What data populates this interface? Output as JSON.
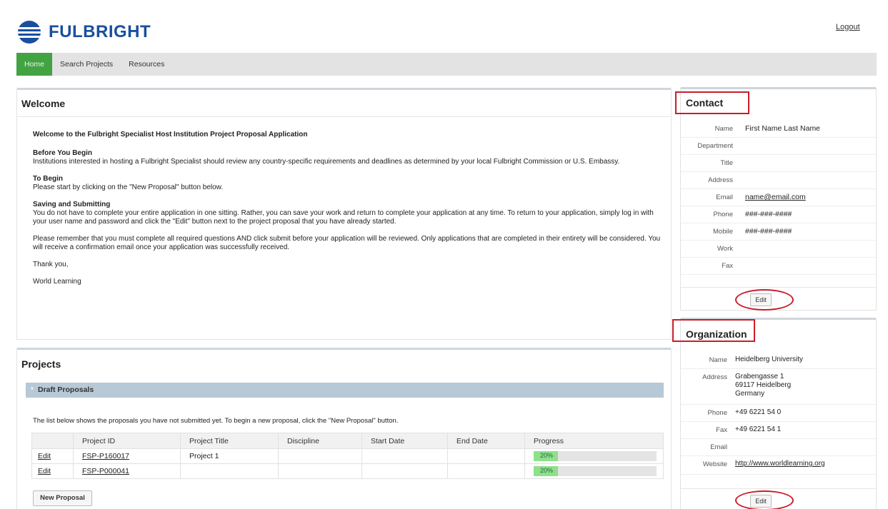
{
  "header": {
    "brand": "FULBRIGHT",
    "logout": "Logout",
    "brand_color": "#1a4f9e"
  },
  "nav": {
    "items": [
      {
        "label": "Home",
        "active": true
      },
      {
        "label": "Search Projects",
        "active": false
      },
      {
        "label": "Resources",
        "active": false
      }
    ],
    "active_color": "#43a343"
  },
  "welcome": {
    "title": "Welcome",
    "intro": "Welcome to the Fulbright Specialist Host Institution Project Proposal Application",
    "sections": [
      {
        "heading": "Before You Begin",
        "text": "Institutions interested in hosting a Fulbright Specialist should review any country-specific requirements and deadlines as determined by your local Fulbright Commission or U.S. Embassy."
      },
      {
        "heading": "To Begin",
        "text": "Please start by clicking on the \"New Proposal\" button below."
      },
      {
        "heading": "Saving and Submitting",
        "text": "You do not have to complete your entire application in one sitting. Rather, you can save your work and return to complete your application at any time. To return to your application, simply log in with your user name and password and click the \"Edit\" button next to the project proposal that you have already started."
      },
      {
        "heading": "",
        "text": "Please remember that you must complete all required questions AND click submit before your application will be reviewed.  Only applications that are completed in their entirety will be considered.  You will receive a confirmation email once your application was successfully received."
      }
    ],
    "thanks": "Thank you,",
    "signature": "World Learning"
  },
  "projects": {
    "title": "Projects",
    "draft_label": "Draft Proposals",
    "note": "The list below shows the proposals you have not submitted yet. To begin a new proposal, click the \"New Proposal\" button.",
    "columns": [
      "",
      "Project ID",
      "Project Title",
      "Discipline",
      "Start Date",
      "End Date",
      "Progress"
    ],
    "rows": [
      {
        "action": "Edit",
        "id": "FSP-P160017",
        "title": "Project 1",
        "discipline": "",
        "start": "",
        "end": "",
        "progress_label": "20%",
        "progress": 0.2
      },
      {
        "action": "Edit",
        "id": "FSP-P000041",
        "title": "",
        "discipline": "",
        "start": "",
        "end": "",
        "progress_label": "20%",
        "progress": 0.2
      }
    ],
    "new_button": "New Proposal"
  },
  "contact": {
    "title": "Contact",
    "fields": [
      {
        "label": "Name",
        "value": "First Name  Last Name"
      },
      {
        "label": "Department",
        "value": ""
      },
      {
        "label": "Title",
        "value": ""
      },
      {
        "label": "Address",
        "value": ""
      },
      {
        "label": "Email",
        "value": "name@email.com",
        "link": true
      },
      {
        "label": "Phone",
        "value": "###-###-####"
      },
      {
        "label": "Mobile",
        "value": "###-###-####"
      },
      {
        "label": "Work",
        "value": ""
      },
      {
        "label": "Fax",
        "value": ""
      }
    ],
    "edit_button": "Edit"
  },
  "organization": {
    "title": "Organization",
    "name_label": "Name",
    "name": "Heidelberg University",
    "address_label": "Address",
    "address_lines": [
      "Grabengasse 1",
      "69117 Heidelberg",
      "Germany"
    ],
    "phone_label": "Phone",
    "phone": "+49 6221 54 0",
    "fax_label": "Fax",
    "fax": "+49 6221 54 1",
    "email_label": "Email",
    "email": "",
    "website_label": "Website",
    "website": "http://www.worldlearning.org",
    "edit_button": "Edit"
  },
  "annotation_color": "#c81e2a"
}
